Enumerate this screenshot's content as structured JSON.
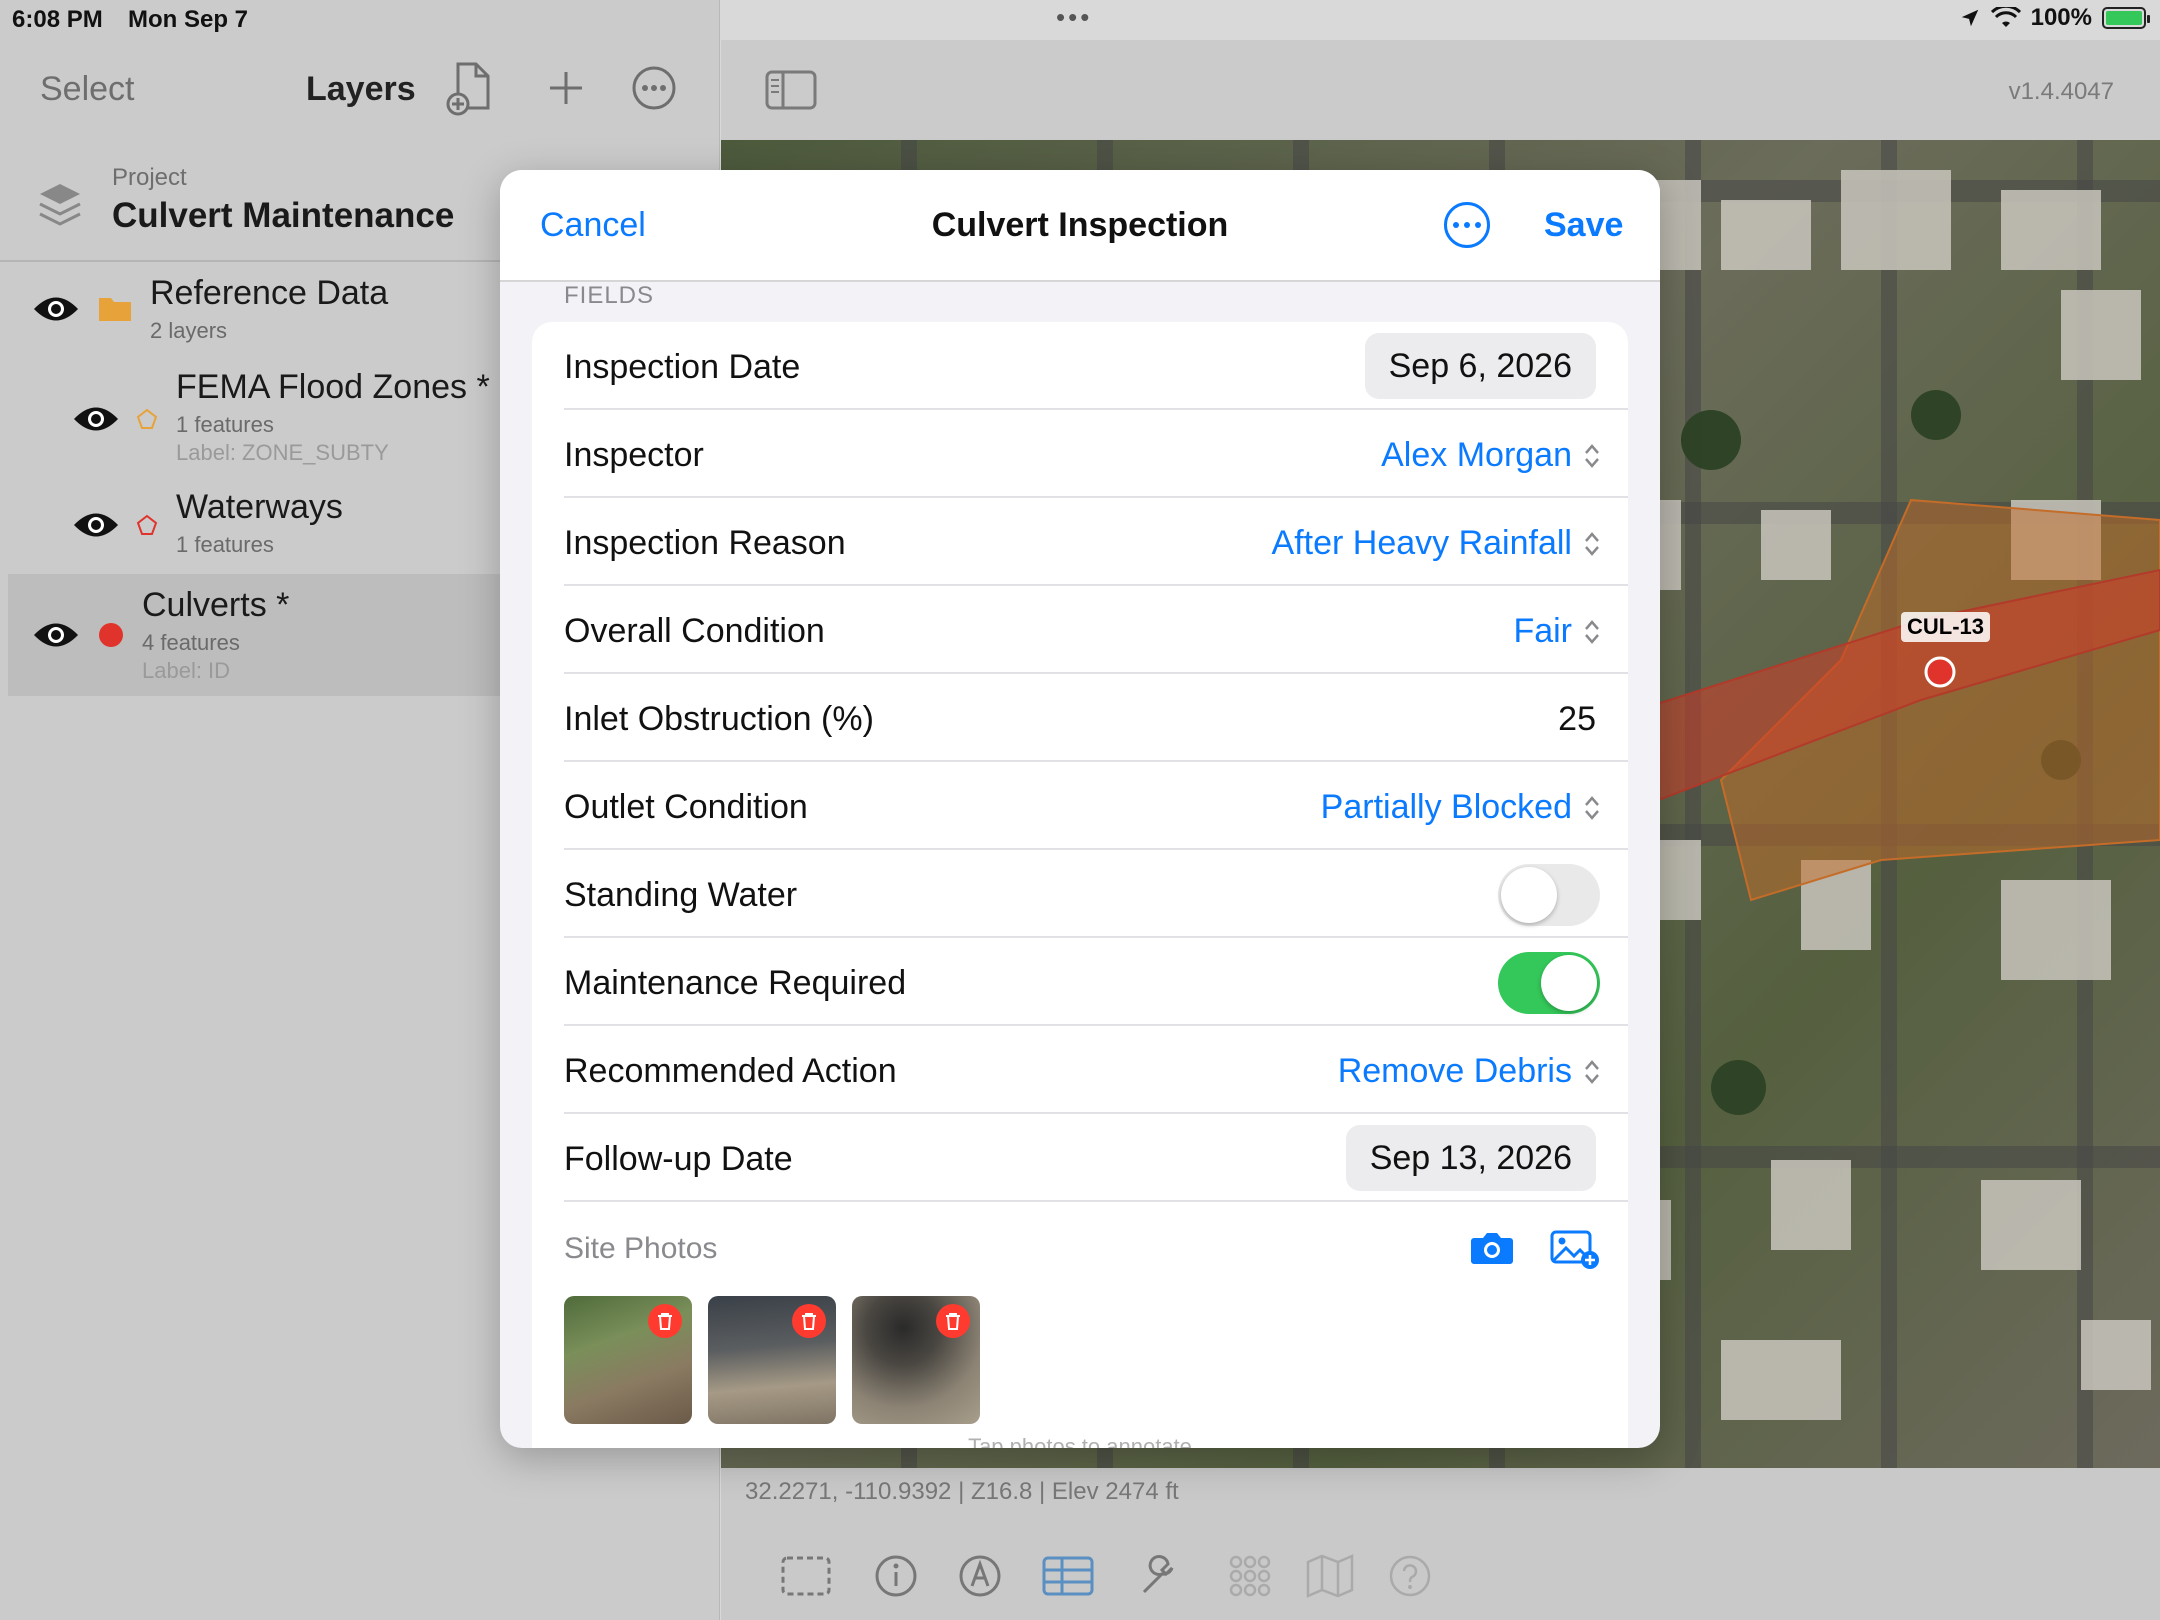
{
  "status_bar": {
    "time": "6:08 PM",
    "date": "Mon Sep 7",
    "battery": "100%"
  },
  "sidebar": {
    "select_label": "Select",
    "title": "Layers",
    "project_label": "Project",
    "project_name": "Culvert Maintenance",
    "layers": [
      {
        "name": "Reference Data",
        "sub": "2 layers",
        "label": "",
        "icon": "folder-icon",
        "color": "#e8a23a"
      },
      {
        "name": "FEMA Flood Zones *",
        "sub": "1 features",
        "label": "Label: ZONE_SUBTY",
        "icon": "polygon-icon",
        "color": "#e8a23a"
      },
      {
        "name": "Waterways",
        "sub": "1 features",
        "label": "",
        "icon": "polygon-icon",
        "color": "#e0332b"
      },
      {
        "name": "Culverts *",
        "sub": "4 features",
        "label": "Label: ID",
        "icon": "point-icon",
        "color": "#e0332b"
      }
    ]
  },
  "map": {
    "version": "v1.4.4047",
    "feature_label": "CUL-13",
    "coords": "32.2271, -110.9392 | Z16.8 | Elev 2474 ft"
  },
  "modal": {
    "cancel": "Cancel",
    "title": "Culvert Inspection",
    "save": "Save",
    "section": "FIELDS",
    "fields": {
      "inspection_date": {
        "label": "Inspection Date",
        "value": "Sep 6, 2026"
      },
      "inspector": {
        "label": "Inspector",
        "value": "Alex Morgan"
      },
      "inspection_reason": {
        "label": "Inspection Reason",
        "value": "After Heavy Rainfall"
      },
      "overall_condition": {
        "label": "Overall Condition",
        "value": "Fair"
      },
      "inlet_obstruction": {
        "label": "Inlet Obstruction (%)",
        "value": "25"
      },
      "outlet_condition": {
        "label": "Outlet Condition",
        "value": "Partially Blocked"
      },
      "standing_water": {
        "label": "Standing Water",
        "value": false
      },
      "maintenance_required": {
        "label": "Maintenance Required",
        "value": true
      },
      "recommended_action": {
        "label": "Recommended Action",
        "value": "Remove Debris"
      },
      "followup_date": {
        "label": "Follow-up Date",
        "value": "Sep 13, 2026"
      }
    },
    "photos_label": "Site Photos",
    "photo_count": 3,
    "hint": "Tap photos to annotate"
  },
  "colors": {
    "accent": "#0a7aff",
    "toggle_on": "#34c759",
    "delete": "#ff3b30"
  }
}
